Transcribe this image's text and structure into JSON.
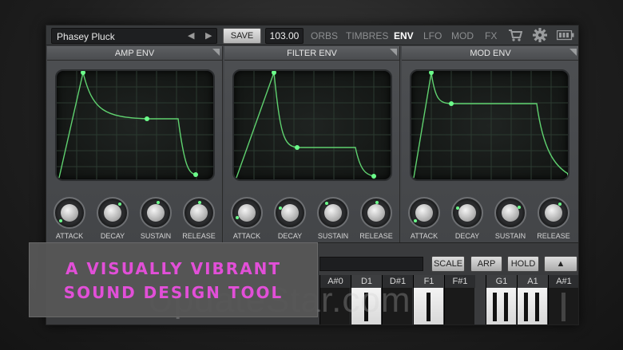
{
  "preset": {
    "name": "Phasey Pluck",
    "prev_icon": "triangle-left-icon",
    "next_icon": "triangle-right-icon"
  },
  "toolbar": {
    "save_label": "SAVE",
    "tempo": "103.00"
  },
  "tabs": [
    {
      "label": "ORBS",
      "active": false
    },
    {
      "label": "TIMBRES",
      "active": false
    },
    {
      "label": "ENV",
      "active": true
    },
    {
      "label": "LFO",
      "active": false
    },
    {
      "label": "MOD",
      "active": false
    },
    {
      "label": "FX",
      "active": false
    }
  ],
  "icons": {
    "store": "cart-icon",
    "settings": "gear-icon",
    "battery": "battery-icon"
  },
  "panels": [
    {
      "title": "AMP ENV",
      "knobs": [
        {
          "label": "ATTACK",
          "value": 0.05
        },
        {
          "label": "DECAY",
          "value": 0.55
        },
        {
          "label": "SUSTAIN",
          "value": 0.55
        },
        {
          "label": "RELEASE",
          "value": 0.5
        }
      ]
    },
    {
      "title": "FILTER ENV",
      "knobs": [
        {
          "label": "ATTACK",
          "value": 0.3
        },
        {
          "label": "DECAY",
          "value": 0.4
        },
        {
          "label": "SUSTAIN",
          "value": 0.35
        },
        {
          "label": "RELEASE",
          "value": 0.5
        }
      ]
    },
    {
      "title": "MOD ENV",
      "knobs": [
        {
          "label": "ATTACK",
          "value": 0.05
        },
        {
          "label": "DECAY",
          "value": 0.3
        },
        {
          "label": "SUSTAIN",
          "value": 0.75
        },
        {
          "label": "RELEASE",
          "value": 0.6
        }
      ]
    }
  ],
  "keyboard": {
    "buttons": [
      "SCALE",
      "ARP",
      "HOLD"
    ],
    "up_icon": "triangle-up-icon",
    "keys": [
      {
        "label": "A#0",
        "white": false
      },
      {
        "label": "D1",
        "white": true
      },
      {
        "label": "D#1",
        "white": false
      },
      {
        "label": "F1",
        "white": true
      },
      {
        "label": "F#1",
        "white": false
      },
      {
        "label": "G1",
        "white": true
      },
      {
        "label": "A1",
        "white": true
      },
      {
        "label": "A#1",
        "white": false
      }
    ]
  },
  "promo": {
    "line1": "A VISUALLY VIBRANT",
    "line2": "SOUND DESIGN TOOL"
  },
  "watermark": "UpdateStar.com",
  "colors": {
    "envelope_line": "#5fd16f",
    "point": "#6cff8b",
    "promo_text": "#e24fd8"
  }
}
